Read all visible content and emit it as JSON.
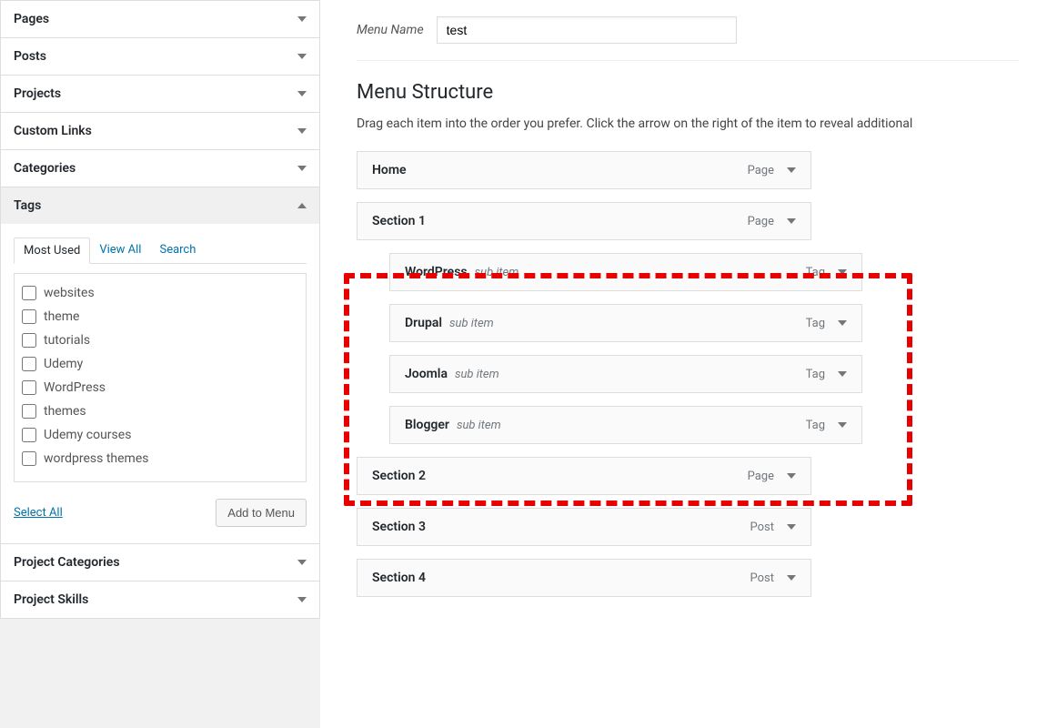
{
  "sidebar": {
    "sections": [
      {
        "title": "Pages",
        "open": false
      },
      {
        "title": "Posts",
        "open": false
      },
      {
        "title": "Projects",
        "open": false
      },
      {
        "title": "Custom Links",
        "open": false
      },
      {
        "title": "Categories",
        "open": false
      },
      {
        "title": "Tags",
        "open": true
      },
      {
        "title": "Project Categories",
        "open": false
      },
      {
        "title": "Project Skills",
        "open": false
      }
    ],
    "tags_panel": {
      "tabs": [
        "Most Used",
        "View All",
        "Search"
      ],
      "selected_tab": 0,
      "items": [
        "websites",
        "theme",
        "tutorials",
        "Udemy",
        "WordPress",
        "themes",
        "Udemy courses",
        "wordpress themes"
      ],
      "select_all": "Select All",
      "add_button": "Add to Menu"
    }
  },
  "main": {
    "menu_name_label": "Menu Name",
    "menu_name_value": "test",
    "structure_heading": "Menu Structure",
    "structure_desc": "Drag each item into the order you prefer. Click the arrow on the right of the item to reveal additional",
    "sub_item_label": "sub item",
    "menu_items": [
      {
        "title": "Home",
        "type": "Page",
        "sub": false
      },
      {
        "title": "Section 1",
        "type": "Page",
        "sub": false
      },
      {
        "title": "WordPress",
        "type": "Tag",
        "sub": true
      },
      {
        "title": "Drupal",
        "type": "Tag",
        "sub": true
      },
      {
        "title": "Joomla",
        "type": "Tag",
        "sub": true
      },
      {
        "title": "Blogger",
        "type": "Tag",
        "sub": true
      },
      {
        "title": "Section 2",
        "type": "Page",
        "sub": false
      },
      {
        "title": "Section 3",
        "type": "Post",
        "sub": false
      },
      {
        "title": "Section 4",
        "type": "Post",
        "sub": false
      }
    ]
  }
}
